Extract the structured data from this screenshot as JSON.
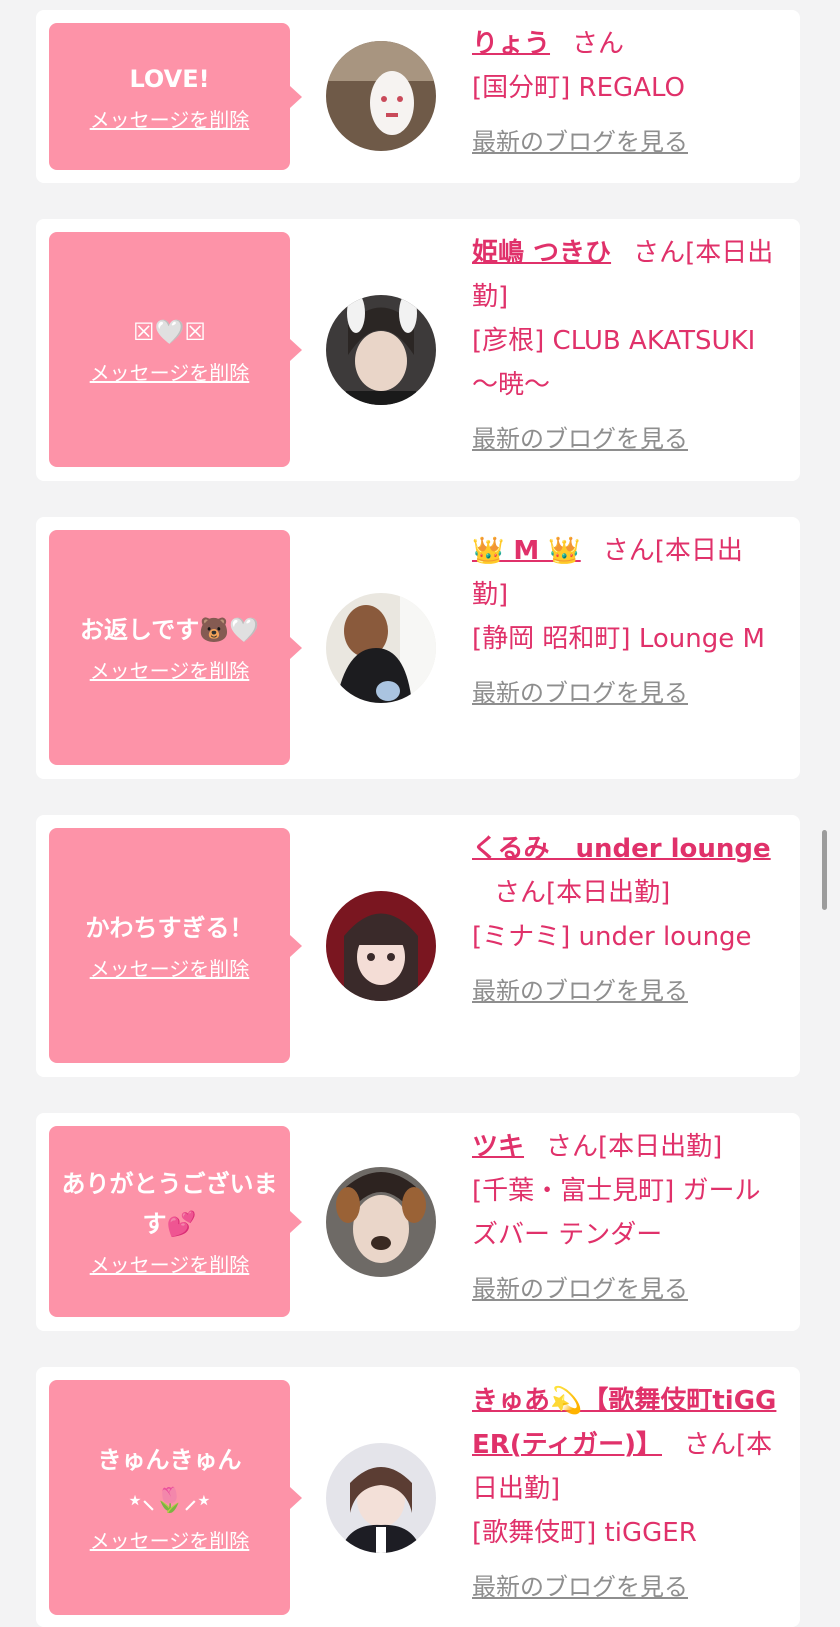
{
  "cards": [
    {
      "message": "LOVE!",
      "delete_label": "メッセージを削除",
      "name": "りょう",
      "suffix": "さん",
      "shop": "[国分町] REGALO",
      "blog_label": "最新のブログを見る"
    },
    {
      "message": "☒🤍☒",
      "delete_label": "メッセージを削除",
      "name": "姫嶋 つきひ",
      "suffix": "さん[本日出勤]",
      "shop": "[彦根] CLUB AKATSUKI 〜暁〜",
      "blog_label": "最新のブログを見る"
    },
    {
      "message": "お返しです🐻🤍",
      "delete_label": "メッセージを削除",
      "name": "👑 M 👑",
      "suffix": "さん[本日出勤]",
      "shop": "[静岡 昭和町] Lounge M",
      "blog_label": "最新のブログを見る"
    },
    {
      "message": "かわちすぎる！",
      "delete_label": "メッセージを削除",
      "name": "くるみ　under lounge",
      "suffix": "さん[本日出勤]",
      "shop": "[ミナミ] under lounge",
      "blog_label": "最新のブログを見る"
    },
    {
      "message": "ありがとうございます💕",
      "delete_label": "メッセージを削除",
      "name": "ツキ",
      "suffix": "さん[本日出勤]",
      "shop": "[千葉・富士見町] ガールズバー テンダー",
      "blog_label": "最新のブログを見る"
    },
    {
      "message": "きゅんきゅん⋆⸜🌷⸝⋆",
      "delete_label": "メッセージを削除",
      "name": "きゅあ💫【歌舞伎町tiGGER(ティガー)】",
      "suffix": "さん[本日出勤]",
      "shop": "[歌舞伎町] tiGGER",
      "blog_label": "最新のブログを見る"
    }
  ],
  "colors": {
    "bubble": "#fd93a8",
    "name": "#e0316a",
    "link_gray": "#8e8e8e",
    "background": "#f3f3f4"
  }
}
